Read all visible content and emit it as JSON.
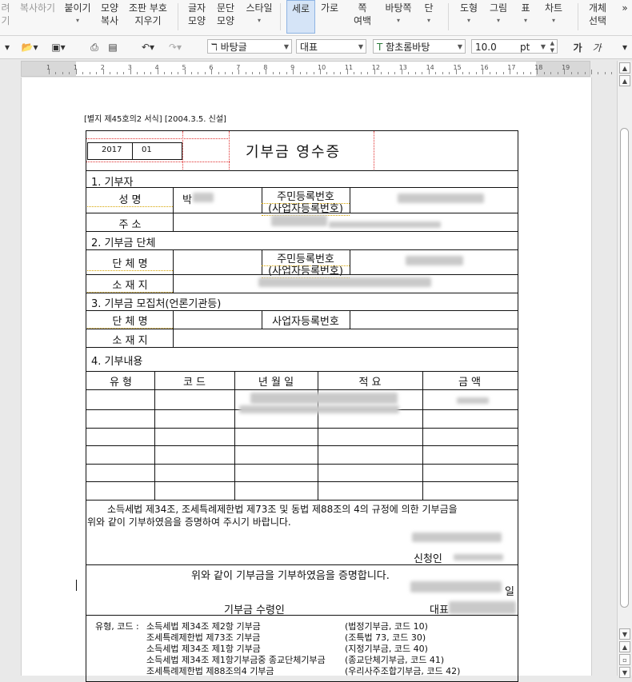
{
  "ribbon": {
    "items": [
      {
        "line1": "려",
        "line2": "기",
        "dim": true
      },
      {
        "line1": "복사하기",
        "line2": "",
        "dim": true
      },
      {
        "line1": "붙이기",
        "line2": ""
      },
      {
        "line1": "모양",
        "line2": "복사"
      },
      {
        "line1": "조판 부호",
        "line2": "지우기"
      },
      {
        "line1": "글자",
        "line2": "모양"
      },
      {
        "line1": "문단",
        "line2": "모양"
      },
      {
        "line1": "스타일",
        "line2": ""
      },
      {
        "line1": "세로",
        "line2": ""
      },
      {
        "line1": "가로",
        "line2": ""
      },
      {
        "line1": "쪽",
        "line2": "여백"
      },
      {
        "line1": "바탕쪽",
        "line2": ""
      },
      {
        "line1": "단",
        "line2": ""
      },
      {
        "line1": "도형",
        "line2": ""
      },
      {
        "line1": "그림",
        "line2": ""
      },
      {
        "line1": "표",
        "line2": ""
      },
      {
        "line1": "차트",
        "line2": ""
      },
      {
        "line1": "개체",
        "line2": "선택"
      }
    ],
    "overflow": "»"
  },
  "toolbar": {
    "style_combo": "바탕글",
    "lang_combo": "대표",
    "font_combo": "함초롬바탕",
    "size_value": "10.0",
    "size_unit": "pt",
    "bold_label": "가",
    "italic_label": "가"
  },
  "ruler": {
    "numbers": [
      "1",
      "1",
      "2",
      "3",
      "4",
      "5",
      "6",
      "7",
      "8",
      "9",
      "10",
      "11",
      "12",
      "13",
      "14",
      "15",
      "16",
      "17",
      "18",
      "19"
    ]
  },
  "form": {
    "caption": "[별지 제45호의2 서식] [2004.3.5. 신설]",
    "year": "2017",
    "serial": "01",
    "title": "기부금 영수증",
    "s1": "1. 기부자",
    "name_label": "성   명",
    "name_value": "박",
    "id_label_1": "주민등록번호",
    "id_label_2": "(사업자등록번호)",
    "addr_label": "주   소",
    "s2": "2. 기부금 단체",
    "org_label": "단 체 명",
    "org_id_label_1": "주민등록번호",
    "org_id_label_2": "(사업자등록번호)",
    "org_addr_label": "소 재 지",
    "s3": "3. 기부금 모집처(언론기관등)",
    "col_org_label": "단 체 명",
    "biz_label": "사업자등록번호",
    "col_addr_label": "소 재 지",
    "s4": "4. 기부내용",
    "headers": [
      "유 형",
      "코 드",
      "년 월 일",
      "적 요",
      "금 액"
    ],
    "statement": "소득세법 제34조, 조세특례제한법 제73조 및 동법 제88조의 4의 규정에 의한 기부금을",
    "statement2": "위와 같이 기부하였음을 증명하여 주시기 바랍니다.",
    "applicant": "신청인",
    "confirm": "위와 같이 기부금을 기부하였음을 증명합니다.",
    "day_suffix": "일",
    "recipient": "기부금 수령인",
    "rep": "대표",
    "foot_prefix": "유형, 코드 :",
    "foot_rows": [
      {
        "left": "소득세법 제34조 제2항 기부금",
        "right": "(법정기부금, 코드 10)"
      },
      {
        "left": "조세특례제한법 제73조 기부금",
        "right": "(조특법 73, 코드 30)"
      },
      {
        "left": "소득세법 제34조 제1항 기부금",
        "right": "(지정기부금, 코드 40)"
      },
      {
        "left": "소득세법 제34조 제1항기부금중 종교단체기부금",
        "right": "(종교단체기부금, 코드 41)"
      },
      {
        "left": "조세특례제한법 제88조의4 기부금",
        "right": "(우리사주조합기부금, 코드 42)"
      }
    ]
  }
}
